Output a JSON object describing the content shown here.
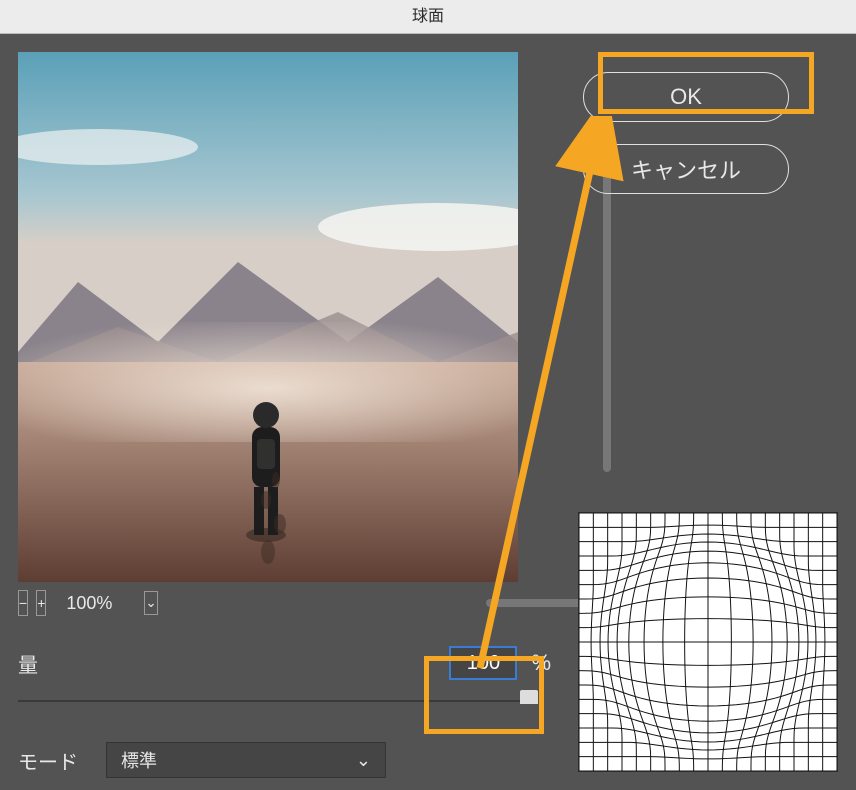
{
  "title": "球面",
  "buttons": {
    "ok": "OK",
    "cancel": "キャンセル"
  },
  "zoom": {
    "value": "100%",
    "minus": "−",
    "plus": "+"
  },
  "amount": {
    "label": "量",
    "value": "100",
    "unit": "%"
  },
  "mode": {
    "label": "モード",
    "value": "標準"
  },
  "icons": {
    "chevron_down": "⌄"
  }
}
